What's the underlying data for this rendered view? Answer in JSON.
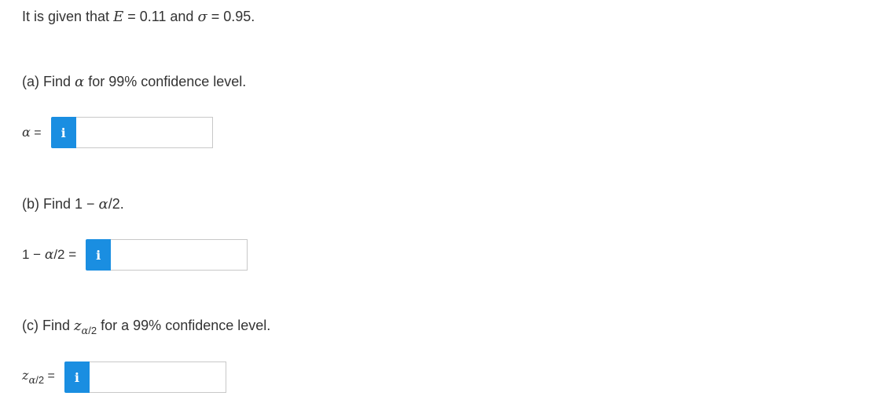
{
  "problem": {
    "statement_prefix": "It is given that ",
    "E_symbol": "E",
    "E_eq": " = 0.11 and ",
    "sigma_symbol": "σ",
    "sigma_eq": " = 0.95."
  },
  "parts": [
    {
      "label": "(a)",
      "text_before": " Find ",
      "symbol": "α",
      "text_after": " for 99% confidence level.",
      "answer_label_symbol": "α",
      "answer_label_eq": " =",
      "info_icon": "i",
      "answer_value": ""
    },
    {
      "label": "(b)",
      "text_before": " Find 1 − ",
      "symbol": "α",
      "text_after": "/2.",
      "answer_label_prefix": "1 − ",
      "answer_label_symbol": "α",
      "answer_label_eq": "/2 =",
      "info_icon": "i",
      "answer_value": ""
    },
    {
      "label": "(c)",
      "text_before": " Find ",
      "symbol": "z",
      "subscript_symbol": "α",
      "subscript_rest": "/2",
      "text_after": " for a 99% confidence level.",
      "answer_label_symbol": "z",
      "answer_label_sub_symbol": "α",
      "answer_label_sub_rest": "/2",
      "answer_label_eq": " =",
      "info_icon": "i",
      "answer_value": ""
    }
  ],
  "colors": {
    "info_button": "#1a8ee1",
    "text": "#333333",
    "input_border": "#c8c8c8"
  }
}
